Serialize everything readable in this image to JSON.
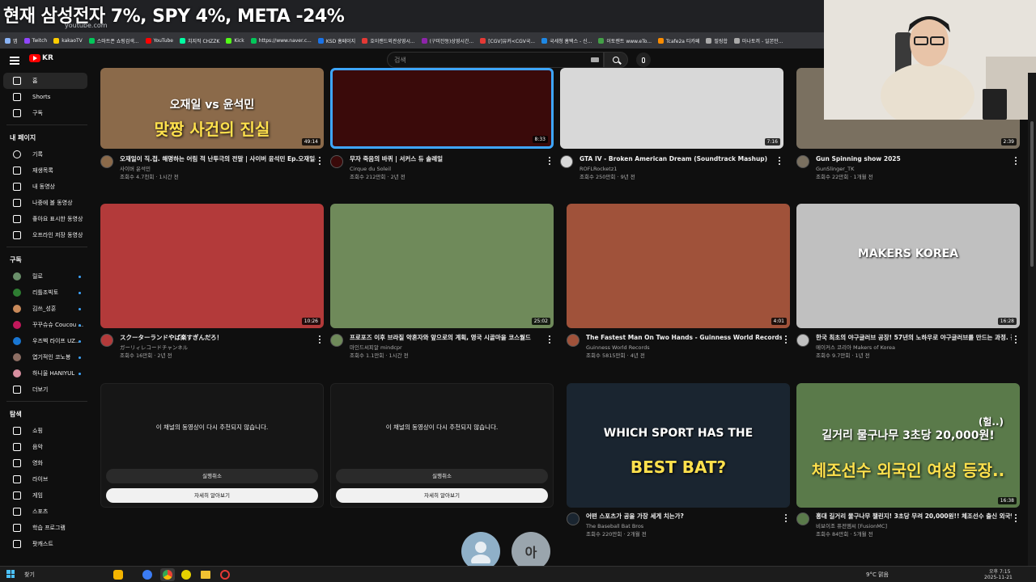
{
  "overlay_title": "현재 삼성전자 7%, SPY 4%, META -24%",
  "browser": {
    "url": "youtube.com",
    "bookmarks": [
      {
        "label": "앱",
        "color": "#8ab4f8"
      },
      {
        "label": "Twitch",
        "color": "#9146ff"
      },
      {
        "label": "kakaoTV",
        "color": "#ffcd00"
      },
      {
        "label": "스마트폰 쇼핑검색...",
        "color": "#03c75a"
      },
      {
        "label": "YouTube",
        "color": "#ff0000"
      },
      {
        "label": "치지직 CHZZK",
        "color": "#00ffa3"
      },
      {
        "label": "Kick",
        "color": "#53fc18"
      },
      {
        "label": "https://www.naver.c...",
        "color": "#03c75a"
      },
      {
        "label": "KSD 홈페이지",
        "color": "#1a73e8"
      },
      {
        "label": "호이랜드외관상영시...",
        "color": "#e53935"
      },
      {
        "label": "(구미잔동)상영시간...",
        "color": "#8e24aa"
      },
      {
        "label": "[CGV]유커<CGV국...",
        "color": "#e53935"
      },
      {
        "label": "국세청 홈택스 - 신...",
        "color": "#1e88e5"
      },
      {
        "label": "이토렌트 www.eTo...",
        "color": "#43a047"
      },
      {
        "label": "Tcafe2a 티카페",
        "color": "#fb8c00"
      },
      {
        "label": "필링합",
        "color": "#aaaaaa"
      },
      {
        "label": "마나토끼 - 일본만...",
        "color": "#aaaaaa"
      }
    ]
  },
  "youtube": {
    "search_placeholder": "검색",
    "logo_text": "KR",
    "sidebar": {
      "main": [
        {
          "label": "홈",
          "icon": "home-icon"
        },
        {
          "label": "Shorts",
          "icon": "shorts-icon"
        },
        {
          "label": "구독",
          "icon": "subscriptions-icon"
        }
      ],
      "you_title": "내 페이지",
      "you": [
        {
          "label": "기록",
          "icon": "history-icon"
        },
        {
          "label": "재생목록",
          "icon": "playlist-icon"
        },
        {
          "label": "내 동영상",
          "icon": "my-videos-icon"
        },
        {
          "label": "나중에 볼 동영상",
          "icon": "watch-later-icon"
        },
        {
          "label": "좋아요 표시한 동영상",
          "icon": "like-icon"
        },
        {
          "label": "오프라인 저장 동영상",
          "icon": "download-icon"
        }
      ],
      "subs_title": "구독",
      "subs": [
        {
          "label": "릴로",
          "color": "#6a8f6a"
        },
        {
          "label": "리틀조빅토",
          "color": "#2e7d32"
        },
        {
          "label": "김쓰_성훈",
          "color": "#c98a5a"
        },
        {
          "label": "꾸꾸슈슈 Coucou ...",
          "color": "#c2185b"
        },
        {
          "label": "우즈벡 라이프 UZ...",
          "color": "#1976d2"
        },
        {
          "label": "엽기적인 코노봉",
          "color": "#8d6e63"
        },
        {
          "label": "하니울 HANIYUL",
          "color": "#d88fa0"
        }
      ],
      "more_label": "더보기",
      "explore_title": "탐색",
      "explore": [
        {
          "label": "쇼핑",
          "icon": "shopping-icon"
        },
        {
          "label": "음악",
          "icon": "music-icon"
        },
        {
          "label": "영화",
          "icon": "movie-icon"
        },
        {
          "label": "라이브",
          "icon": "live-icon"
        },
        {
          "label": "게임",
          "icon": "gaming-icon"
        },
        {
          "label": "스포츠",
          "icon": "sports-icon"
        },
        {
          "label": "학습 프로그램",
          "icon": "learning-icon"
        },
        {
          "label": "팟캐스트",
          "icon": "podcast-icon"
        }
      ]
    },
    "row1": [
      {
        "title": "오재일이 직.접. 해명하는 어림 적 난투극의 전말 | 사이버 윤석민 Ep.오재일-1",
        "channel": "사이버 윤석민",
        "stats": "조회수 4.7천회 · 1시간 전",
        "duration": "49:14",
        "thumb_text": "오재일 vs 윤석민",
        "thumb_text2": "맞짱 사건의 진실",
        "color": "#8b6a4a"
      },
      {
        "title": "무자 죽음의 바퀴 | 서커스 듀 솔레일",
        "channel": "Cirque du Soleil",
        "stats": "조회수 212만회 · 2년 전",
        "duration": "8:33",
        "color": "#3a0a0a"
      },
      {
        "title": "GTA IV - Broken American Dream (Soundtrack Mashup)",
        "channel": "ROFLRocketz1",
        "stats": "조회수 250만회 · 9년 전",
        "duration": "7:16",
        "color": "#d8d8d8"
      },
      {
        "title": "Gun Spinning show 2025",
        "channel": "GunSlinger_TK",
        "stats": "조회수 22만회 · 1개월 전",
        "duration": "2:39",
        "color": "#7a7060"
      }
    ],
    "row2": [
      {
        "title": "スクーターランドやば楽すぎんだろ！",
        "channel": "ガーリィレコードチャンネル",
        "stats": "조회수 16만회 · 2년 전",
        "duration": "10:26",
        "color": "#b33a3a"
      },
      {
        "title": "프로포즈 이후 브라질 약혼자와 앞으로의 계획, 영국 시골마을 코스월드",
        "channel": "마인드씨피알 mindcpr",
        "stats": "조회수 1.1만회 · 1시간 전",
        "duration": "25:02",
        "color": "#6f8a5a"
      },
      {
        "title": "The Fastest Man On Two Hands - Guinness World Records",
        "channel": "Guinness World Records",
        "stats": "조회수 5815만회 · 4년 전",
        "duration": "4:01",
        "color": "#a0523a"
      },
      {
        "title": "한국 최초의 야구글러브 공장! 57년의 노하우로 야구글러브를 만드는 과정. 김해산업사(JOE LEE)",
        "channel": "메이커스 코리아 Makers of Korea",
        "stats": "조회수 9.7만회 · 1년 전",
        "duration": "16:28",
        "thumb_text": "MAKERS KOREA",
        "color": "#c0c0c0"
      }
    ],
    "blocked": {
      "message": "이 채널의 동영상이 다시 추천되지 않습니다.",
      "undo": "실행취소",
      "learn_more": "자세히 알아보기"
    },
    "row3": [
      {
        "title": "어떤 스포츠가 공을 가장 세게 치는가?",
        "channel": "The Baseball Bat Bros",
        "stats": "조회수 220만회 · 2개월 전",
        "duration": "",
        "thumb_text": "WHICH SPORT HAS THE",
        "thumb_text2": "BEST BAT?",
        "color": "#1a2530"
      },
      {
        "title": "홍대 길거리 물구나무 챌린지! 3초당 무려 20,000원!! 체조선수 출신 외국인 여성 등장 헐...",
        "channel": "비보이조 퓨전엠씨 [FusionMC]",
        "stats": "조회수 84만회 · 5개월 전",
        "duration": "16:38",
        "thumb_text": "길거리 물구나무 3초당 20,000원!",
        "thumb_text2": "체조선수 외국인 여성 등장..",
        "thumb_text3": "(헐..)",
        "color": "#5a7a4a"
      }
    ]
  },
  "bubble_label": "아",
  "taskbar": {
    "search": "찾기",
    "weather": "9°C 맑음",
    "time": "오후 7:15",
    "date": "2025-11-21"
  }
}
